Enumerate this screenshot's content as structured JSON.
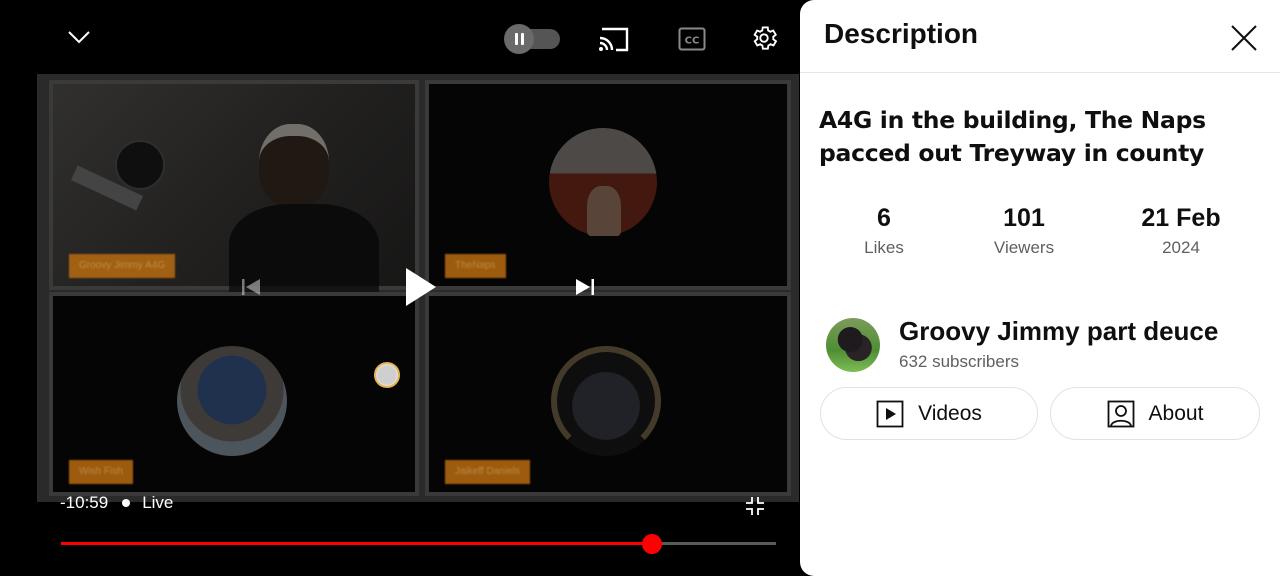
{
  "player": {
    "top_controls": {
      "minimize": "chevron-down-icon",
      "autoplay_toggle": "pause-icon",
      "cast": "cast-icon",
      "captions": "CC",
      "settings": "gear-icon"
    },
    "video_tiles": [
      {
        "name_tag": "Groovy Jimmy A4G",
        "content": "webcam"
      },
      {
        "name_tag": "TheNaps",
        "content": "avatar"
      },
      {
        "name_tag": "Wish Fish",
        "content": "avatar"
      },
      {
        "name_tag": "Jaikeff Daniels",
        "content": "avatar"
      }
    ],
    "center_controls": {
      "previous": "skip-previous-icon",
      "play": "play-icon",
      "next": "skip-next-icon"
    },
    "time_remaining": "-10:59",
    "live_label": "Live",
    "progress_percent": 82.7,
    "colors": {
      "progress": "#ff0000",
      "track": "#5a5a5a"
    }
  },
  "description_panel": {
    "title": "Description",
    "close": "close-icon",
    "video_title": "A4G in the building, The Naps pacced out Treyway in county",
    "stats": [
      {
        "value": "6",
        "label": "Likes"
      },
      {
        "value": "101",
        "label": "Viewers"
      },
      {
        "value": "21 Feb",
        "label": "2024"
      }
    ],
    "channel": {
      "name": "Groovy Jimmy part deuce",
      "subscribers": "632 subscribers"
    },
    "buttons": [
      {
        "label": "Videos",
        "icon": "video-icon"
      },
      {
        "label": "About",
        "icon": "person-icon"
      }
    ]
  }
}
